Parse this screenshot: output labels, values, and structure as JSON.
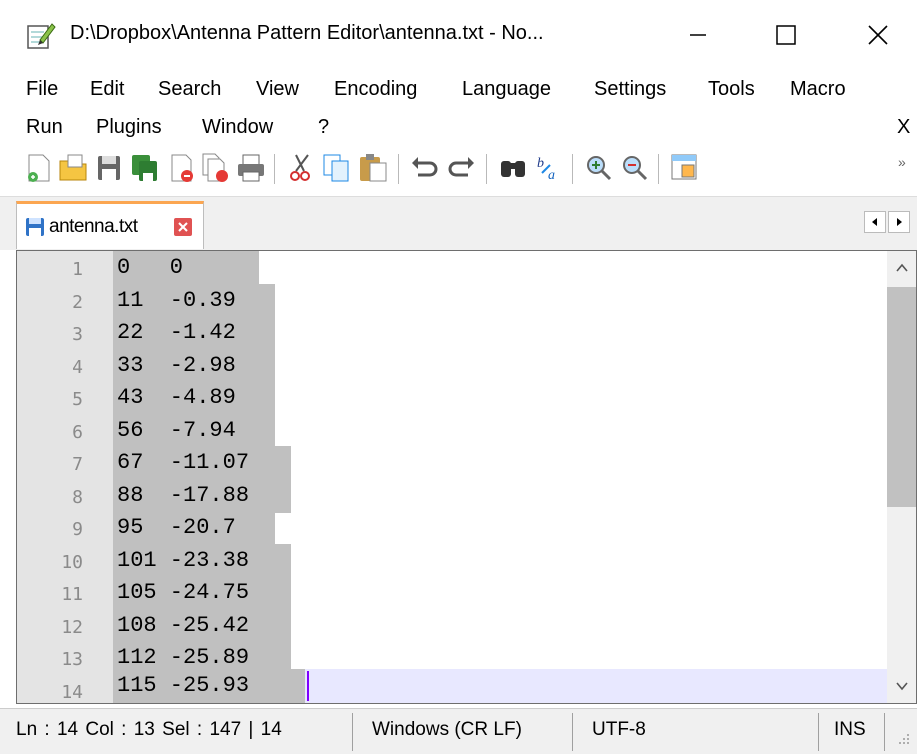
{
  "window": {
    "title": "D:\\Dropbox\\Antenna Pattern Editor\\antenna.txt - No...",
    "minimize_symbol": "—",
    "maximize_symbol": "☐",
    "close_symbol": "✕"
  },
  "menu": {
    "items": [
      "File",
      "Edit",
      "Search",
      "View",
      "Encoding",
      "Language",
      "Settings",
      "Tools",
      "Macro",
      "Run",
      "Plugins",
      "Window",
      "?"
    ],
    "close_doc": "X"
  },
  "toolbar": {
    "icons": [
      "new-file-icon",
      "open-file-icon",
      "save-icon",
      "save-all-icon",
      "close-icon",
      "close-all-icon",
      "print-icon",
      "cut-icon",
      "copy-icon",
      "paste-icon",
      "undo-icon",
      "redo-icon",
      "find-icon",
      "replace-icon",
      "zoom-in-icon",
      "zoom-out-icon",
      "sync-scroll-icon"
    ],
    "more": "»"
  },
  "tab": {
    "label": "antenna.txt"
  },
  "editor": {
    "lines": [
      {
        "no": "1",
        "text": "0   0"
      },
      {
        "no": "2",
        "text": "11  -0.39"
      },
      {
        "no": "3",
        "text": "22  -1.42"
      },
      {
        "no": "4",
        "text": "33  -2.98"
      },
      {
        "no": "5",
        "text": "43  -4.89"
      },
      {
        "no": "6",
        "text": "56  -7.94"
      },
      {
        "no": "7",
        "text": "67  -11.07"
      },
      {
        "no": "8",
        "text": "88  -17.88"
      },
      {
        "no": "9",
        "text": "95  -20.7"
      },
      {
        "no": "10",
        "text": "101 -23.38"
      },
      {
        "no": "11",
        "text": "105 -24.75"
      },
      {
        "no": "12",
        "text": "108 -25.42"
      },
      {
        "no": "13",
        "text": "112 -25.89"
      },
      {
        "no": "14",
        "text": "115 -25.93"
      }
    ]
  },
  "status": {
    "position": "Ln : 14    Col : 13    Sel : 147 | 14",
    "eol": "Windows (CR LF)",
    "encoding": "UTF-8",
    "mode": "INS"
  },
  "colors": {
    "tab_accent": "#fba651",
    "selection": "#c0c0c0",
    "caret": "#8000ff",
    "current_line": "#e8e8ff"
  }
}
